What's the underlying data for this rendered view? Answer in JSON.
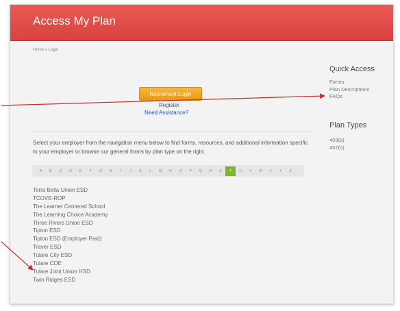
{
  "header": {
    "title": "Access My Plan"
  },
  "breadcrumb": "Home » Login",
  "main": {
    "login_button": "Retirement Login",
    "register_link": "Register",
    "assistance_link": "Need Assistance?",
    "intro": "Select your employer from the navigation menu below to find forms, resources, and additional information specific to your employer or browse our general forms by plan type on the right.",
    "alphabet": [
      "A",
      "B",
      "C",
      "D",
      "E",
      "F",
      "G",
      "H",
      "I",
      "J",
      "K",
      "L",
      "M",
      "N",
      "O",
      "P",
      "Q",
      "R",
      "S",
      "T",
      "U",
      "V",
      "W",
      "X",
      "Y",
      "Z"
    ],
    "active_letter": "T",
    "employers": [
      "Terra Bella Union ESD",
      "TCOVE-ROP",
      "The Learner Centered School",
      "The Learning Choice Academy",
      "Three Rivers Union ESD",
      "Tipton ESD",
      "Tipton ESD (Employer Paid)",
      "Traver ESD",
      "Tulare City ESD",
      "Tulare COE",
      "Tulare Joint Union HSD",
      "Twin Ridges ESD"
    ]
  },
  "sidebar": {
    "quick_access_title": "Quick Access",
    "quick_links": [
      "Forms",
      "Plan Descriptions",
      "FAQs"
    ],
    "plan_types_title": "Plan Types",
    "plan_types": [
      "403(b)",
      "457(b)"
    ]
  },
  "colors": {
    "header": "#d9433f",
    "button": "#eea22a",
    "active_letter": "#7fb32f",
    "arrow": "#d42a2a"
  }
}
